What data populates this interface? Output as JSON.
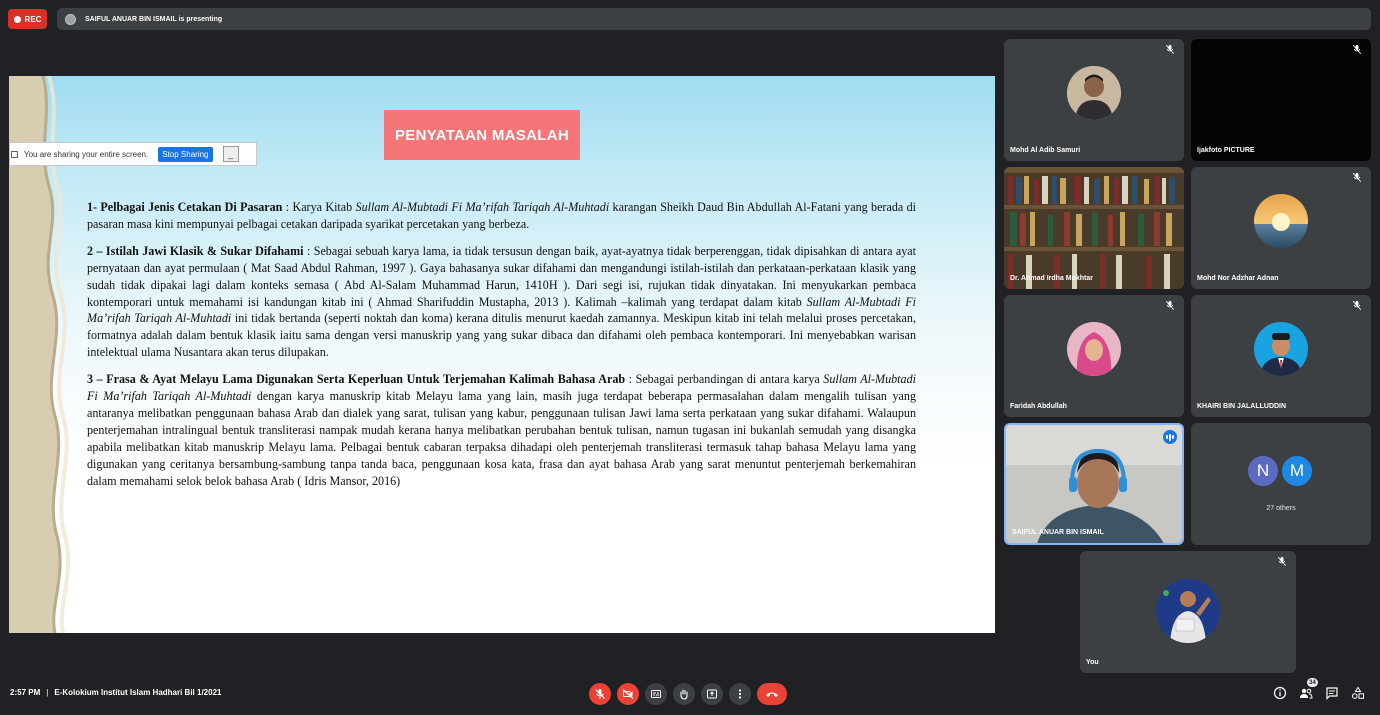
{
  "recording": {
    "label": "REC"
  },
  "presenter_banner": {
    "text": "SAIFUL ANUAR BIN ISMAIL is presenting"
  },
  "slide": {
    "title": "PENYATAAN MASALAH",
    "share_notice": {
      "text": "You are sharing your entire screen.",
      "stop_label": "Stop Sharing",
      "hide_label": "_"
    },
    "paragraphs": [
      {
        "heading": "1- Pelbagai Jenis Cetakan Di Pasaran",
        "segments": [
          {
            "t": " : Karya Kitab ",
            "i": false
          },
          {
            "t": "Sullam Al-Mubtadi Fi Ma’rifah Tariqah Al-Muhtadi",
            "i": true
          },
          {
            "t": " karangan Sheikh Daud Bin Abdullah Al-Fatani yang berada di pasaran masa kini mempunyai pelbagai cetakan daripada syarikat percetakan yang berbeza.",
            "i": false
          }
        ]
      },
      {
        "heading": "2 – Istilah Jawi Klasik & Sukar Difahami",
        "segments": [
          {
            "t": " : Sebagai sebuah karya lama, ia tidak tersusun dengan baik, ayat-ayatnya tidak berperenggan, tidak dipisahkan di antara ayat pernyataan dan ayat permulaan ( Mat Saad Abdul Rahman, 1997 ). Gaya bahasanya sukar difahami dan mengandungi istilah-istilah dan perkataan-perkataan klasik yang sudah tidak dipakai lagi dalam konteks semasa ( Abd Al-Salam Muhammad Harun, 1410H ).  Dari segi isi, rujukan tidak dinyatakan. Ini menyukarkan pembaca kontemporari untuk memahami isi kandungan kitab ini ( Ahmad Sharifuddin Mustapha, 2013 ). Kalimah –kalimah yang terdapat dalam kitab ",
            "i": false
          },
          {
            "t": "Sullam Al-Mubtadi Fi Ma’rifah Tariqah Al-Muhtadi",
            "i": true
          },
          {
            "t": " ini tidak bertanda (seperti noktah dan koma) kerana ditulis menurut kaedah zamannya. Meskipun kitab ini telah melalui proses percetakan, formatnya adalah dalam bentuk klasik iaitu sama dengan versi manuskrip yang yang sukar dibaca dan difahami oleh pembaca kontemporari. Ini menyebabkan warisan intelektual ulama Nusantara akan terus dilupakan.",
            "i": false
          }
        ]
      },
      {
        "heading": "3 – Frasa & Ayat Melayu Lama Digunakan Serta Keperluan Untuk Terjemahan Kalimah Bahasa Arab",
        "segments": [
          {
            "t": " :  Sebagai perbandingan di antara karya ",
            "i": false
          },
          {
            "t": "Sullam Al-Mubtadi Fi Ma’rifah Tariqah Al-Muhtadi",
            "i": true
          },
          {
            "t": " dengan karya manuskrip kitab Melayu lama yang lain, masih juga terdapat beberapa permasalahan dalam mengalih tulisan yang antaranya melibatkan penggunaan bahasa Arab dan dialek yang sarat, tulisan yang kabur, penggunaan tulisan Jawi lama serta perkataan yang sukar difahami. Walaupun penterjemahan intralingual bentuk transliterasi nampak mudah kerana hanya melibatkan perubahan bentuk tulisan, namun tugasan ini bukanlah semudah yang disangka apabila melibatkan kitab manuskrip Melayu lama. Pelbagai bentuk cabaran terpaksa dihadapi oleh penterjemah transliterasi termasuk tahap bahasa Melayu lama yang digunakan yang ceritanya bersambung-sambung tanpa tanda baca, penggunaan kosa kata, frasa dan ayat bahasa Arab yang sarat menuntut penterjemah berkemahiran dalam memahami selok belok bahasa Arab ( Idris Mansor, 2016)",
            "i": false
          }
        ]
      }
    ]
  },
  "participants": [
    {
      "name": "Mohd Al Adib Samuri",
      "kind": "avatar",
      "muted": true
    },
    {
      "name": "Ijakfoto PICTURE",
      "kind": "black",
      "muted": true
    },
    {
      "name": "Dr. Ahmad Irdha Mokhtar",
      "kind": "bookshelf",
      "muted": false
    },
    {
      "name": "Mohd Nor Adzhar Adnan",
      "kind": "sunset",
      "muted": true
    },
    {
      "name": "Faridah Abdullah",
      "kind": "avatar-pink",
      "muted": true
    },
    {
      "name": "KHAIRI BIN JALALLUDDIN",
      "kind": "avatar-blue",
      "muted": true
    },
    {
      "name": "SAIFUL ANUAR BIN ISMAIL",
      "kind": "video",
      "muted": false,
      "speaking": true
    },
    {
      "name": "27 others",
      "kind": "others",
      "initials": [
        "N",
        "M"
      ]
    },
    {
      "name": "You",
      "kind": "avatar-you",
      "muted": true
    }
  ],
  "bottom": {
    "time": "2:57 PM",
    "meeting_title": "E-Kolokium Institut Islam Hadhari Bil 1/2021",
    "participant_count": "34"
  },
  "icons": [
    "mic-off-icon",
    "camera-off-icon",
    "captions-icon",
    "raise-hand-icon",
    "present-icon",
    "more-options-icon",
    "end-call-icon",
    "info-icon",
    "people-icon",
    "chat-icon",
    "activities-icon"
  ],
  "colors": {
    "end_call": "#ea4335",
    "rec": "#d93025",
    "slide_title_bg": "#f47678",
    "stop_sharing": "#1a73e8"
  }
}
